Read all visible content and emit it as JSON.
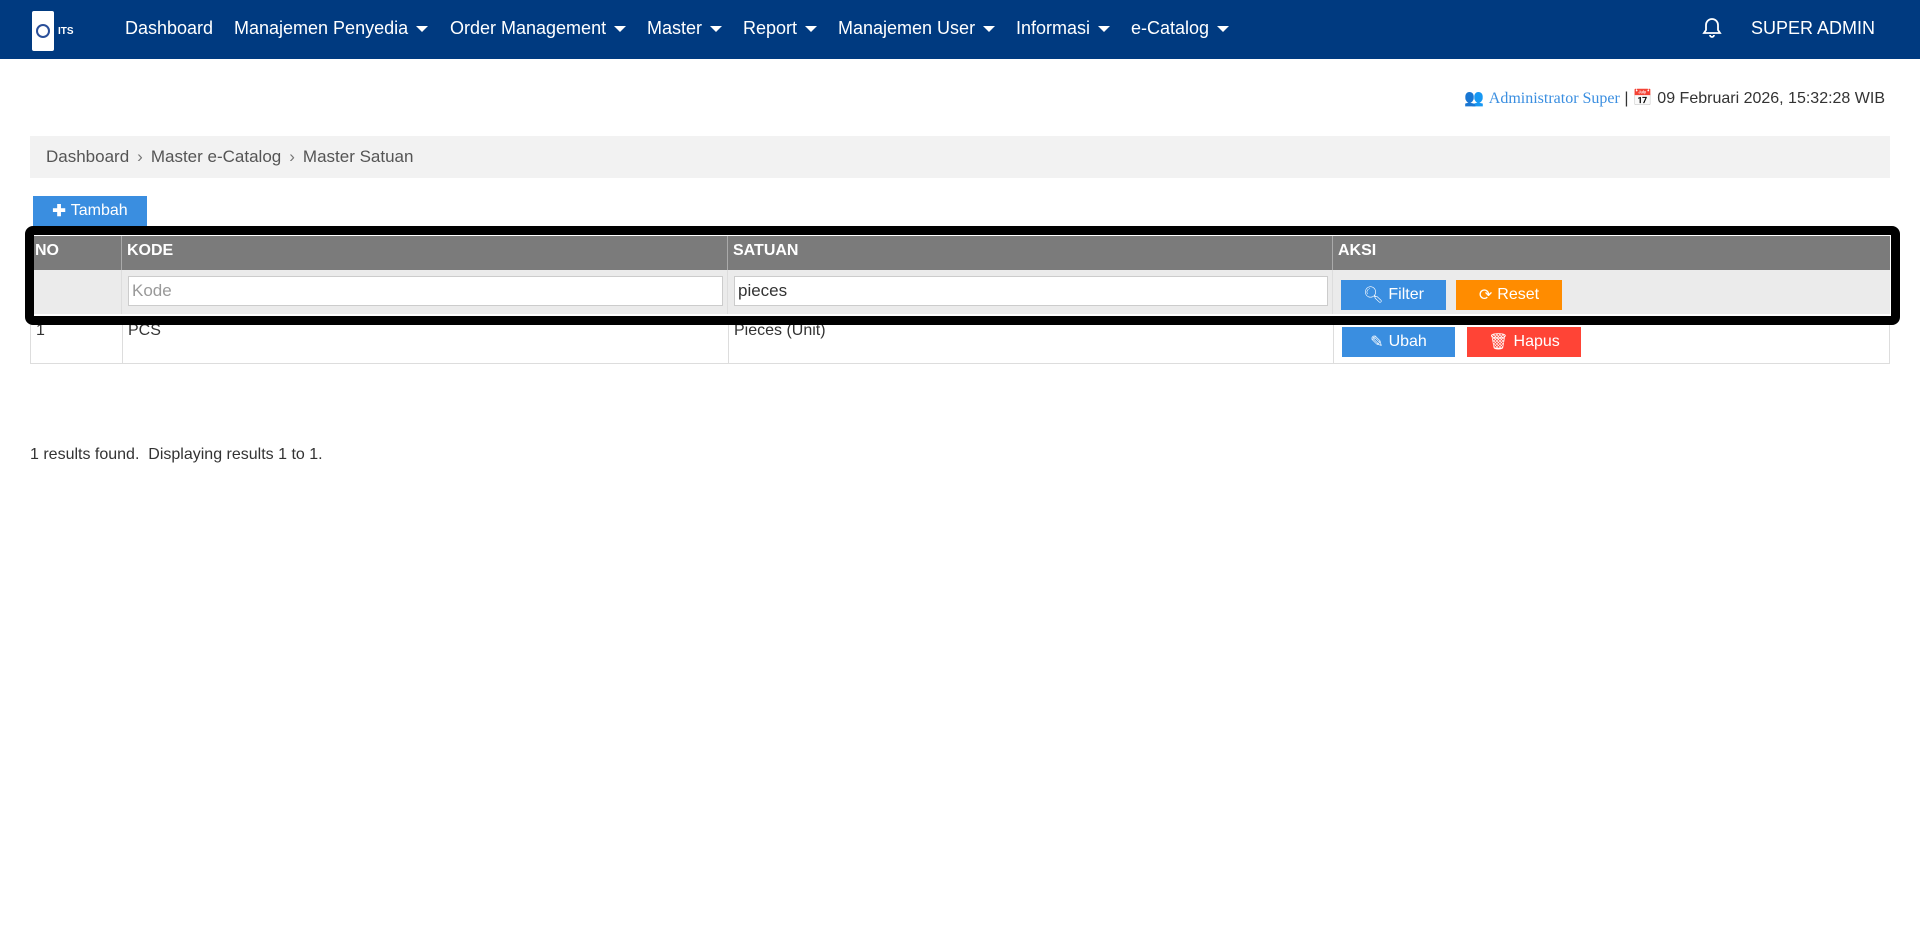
{
  "nav": {
    "logo_text": "ITS",
    "items": [
      {
        "label": "Dashboard",
        "dropdown": false
      },
      {
        "label": "Manajemen Penyedia",
        "dropdown": true
      },
      {
        "label": "Order Management",
        "dropdown": true
      },
      {
        "label": "Master",
        "dropdown": true
      },
      {
        "label": "Report",
        "dropdown": true
      },
      {
        "label": "Manajemen User",
        "dropdown": true
      },
      {
        "label": "Informasi",
        "dropdown": true
      },
      {
        "label": "e-Catalog",
        "dropdown": true
      }
    ],
    "user_label": "SUPER ADMIN"
  },
  "userinfo": {
    "name": "Administrator Super",
    "separator": "|",
    "datetime": "09 Februari 2026, 15:32:28 WIB"
  },
  "breadcrumb": [
    "Dashboard",
    "Master e-Catalog",
    "Master Satuan"
  ],
  "add_button": "Tambah",
  "table": {
    "headers": [
      "NO",
      "KODE",
      "SATUAN",
      "AKSI"
    ],
    "filters": {
      "kode_placeholder": "Kode",
      "kode_value": "",
      "satuan_value": "pieces",
      "filter_label": "Filter",
      "reset_label": "Reset"
    },
    "rows": [
      {
        "no": "1",
        "kode": "PCS",
        "satuan": "Pieces (Unit)",
        "edit_label": "Ubah",
        "delete_label": "Hapus"
      }
    ]
  },
  "summary": "1 results found.  Displaying results 1 to 1.",
  "colors": {
    "nav": "#003a80",
    "primary": "#3a8ee0",
    "warning": "#ff8c00",
    "danger": "#ff4436"
  }
}
